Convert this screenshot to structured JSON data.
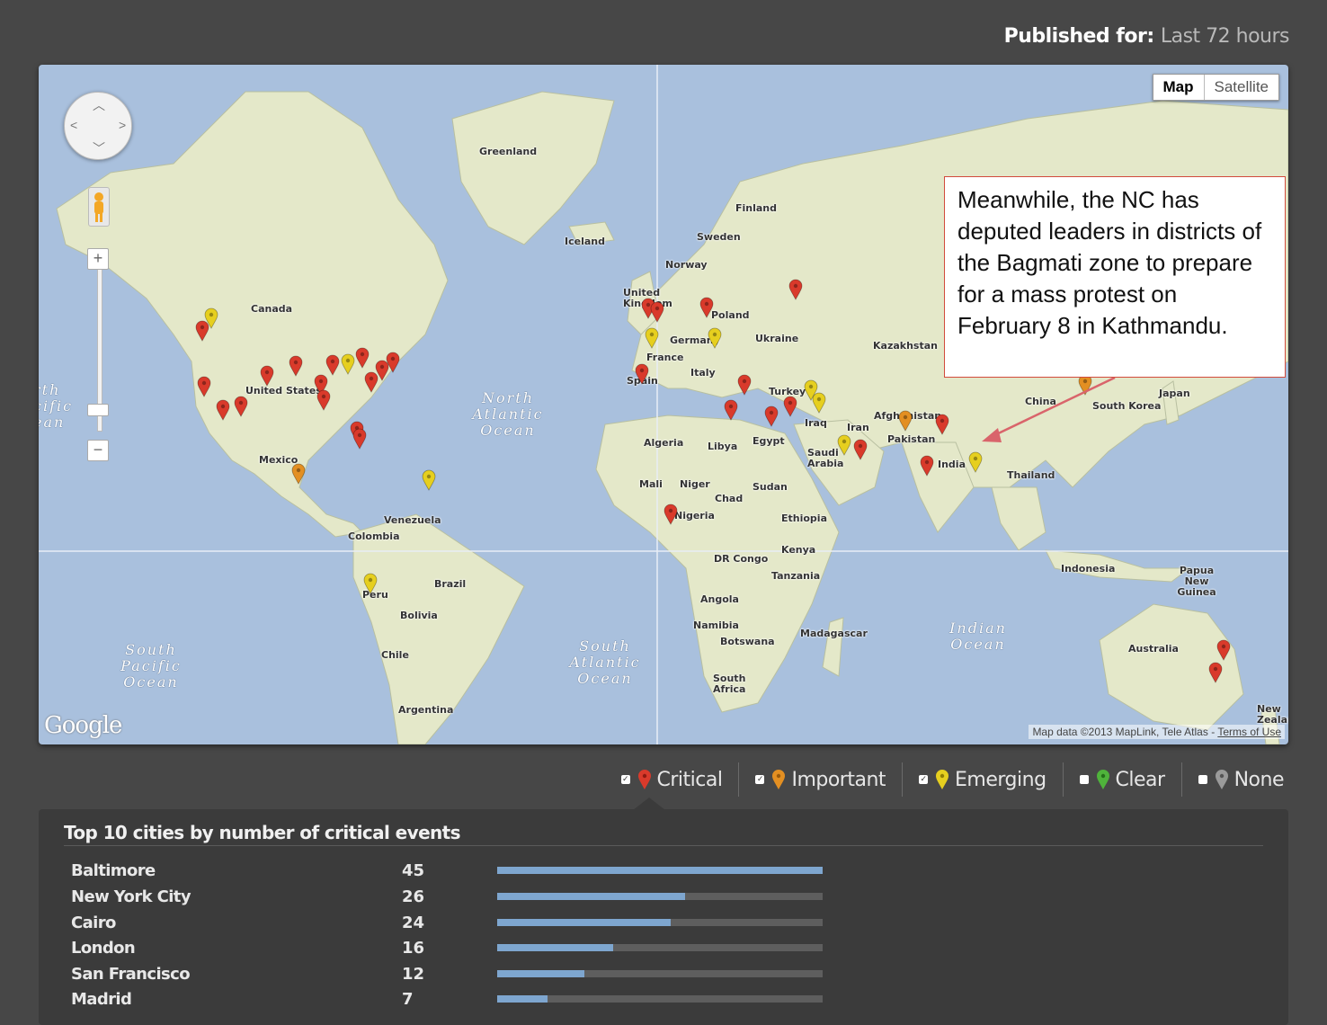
{
  "header": {
    "published_label": "Published for:",
    "published_value": "Last 72 hours"
  },
  "map": {
    "type_buttons": [
      "Map",
      "Satellite"
    ],
    "active_type": "Map",
    "attribution": "Map data ©2013 MapLink, Tele Atlas",
    "terms": "Terms of Use",
    "logo": "Google",
    "zoom_in": "+",
    "zoom_out": "−",
    "labels": {
      "greenland": "Greenland",
      "iceland": "Iceland",
      "finland": "Finland",
      "sweden": "Sweden",
      "norway": "Norway",
      "uk": "United Kingdom",
      "poland": "Poland",
      "germany": "Germany",
      "ukraine": "Ukraine",
      "france": "France",
      "italy": "Italy",
      "spain": "Spain",
      "kazakhstan": "Kazakhstan",
      "turkey": "Turkey",
      "iraq": "Iraq",
      "iran": "Iran",
      "afghanistan": "Afghanistan",
      "pakistan": "Pakistan",
      "china": "China",
      "japan": "Japan",
      "south_korea": "South Korea",
      "india": "India",
      "thailand": "Thailand",
      "saudi_arabia": "Saudi Arabia",
      "egypt": "Egypt",
      "libya": "Libya",
      "algeria": "Algeria",
      "mali": "Mali",
      "niger": "Niger",
      "chad": "Chad",
      "sudan": "Sudan",
      "nigeria": "Nigeria",
      "ethiopia": "Ethiopia",
      "kenya": "Kenya",
      "dr_congo": "DR Congo",
      "tanzania": "Tanzania",
      "angola": "Angola",
      "namibia": "Namibia",
      "botswana": "Botswana",
      "madagascar": "Madagascar",
      "south_africa": "South Africa",
      "indonesia": "Indonesia",
      "papua": "Papua New Guinea",
      "australia": "Australia",
      "new_zealand": "New Zealand",
      "canada": "Canada",
      "united_states": "United States",
      "mexico": "Mexico",
      "venezuela": "Venezuela",
      "colombia": "Colombia",
      "brazil": "Brazil",
      "peru": "Peru",
      "bolivia": "Bolivia",
      "chile": "Chile",
      "argentina": "Argentina"
    },
    "oceans": {
      "north_atlantic": "North Atlantic Ocean",
      "south_atlantic": "South Atlantic Ocean",
      "south_pacific": "South Pacific Ocean",
      "north_pacific": "rth cific ean",
      "indian": "Indian Ocean"
    },
    "marker_colors": {
      "critical": "#d93a2b",
      "important": "#e38f22",
      "emerging": "#e6cf1f",
      "clear": "#4fb33b",
      "none": "#9a9a9a"
    }
  },
  "callout": {
    "text": "Meanwhile, the NC has deputed leaders in districts of the Bagmati zone to prepare for a mass protest on February 8 in Kathmandu."
  },
  "legend": {
    "items": [
      {
        "label": "Critical",
        "checked": true,
        "icon": "red-pin-icon"
      },
      {
        "label": "Important",
        "checked": true,
        "icon": "orange-pin-icon"
      },
      {
        "label": "Emerging",
        "checked": true,
        "icon": "yellow-pin-icon"
      },
      {
        "label": "Clear",
        "checked": false,
        "icon": "green-pin-icon"
      },
      {
        "label": "None",
        "checked": false,
        "icon": "gray-pin-icon"
      }
    ]
  },
  "top_cities": {
    "title": "Top 10 cities by number of critical events",
    "rows": [
      {
        "city": "Baltimore",
        "count": "45",
        "fraction": 1.0
      },
      {
        "city": "New York City",
        "count": "26",
        "fraction": 0.578
      },
      {
        "city": "Cairo",
        "count": "24",
        "fraction": 0.533
      },
      {
        "city": "London",
        "count": "16",
        "fraction": 0.356
      },
      {
        "city": "San Francisco",
        "count": "12",
        "fraction": 0.267
      },
      {
        "city": "Madrid",
        "count": "7",
        "fraction": 0.156
      }
    ]
  }
}
